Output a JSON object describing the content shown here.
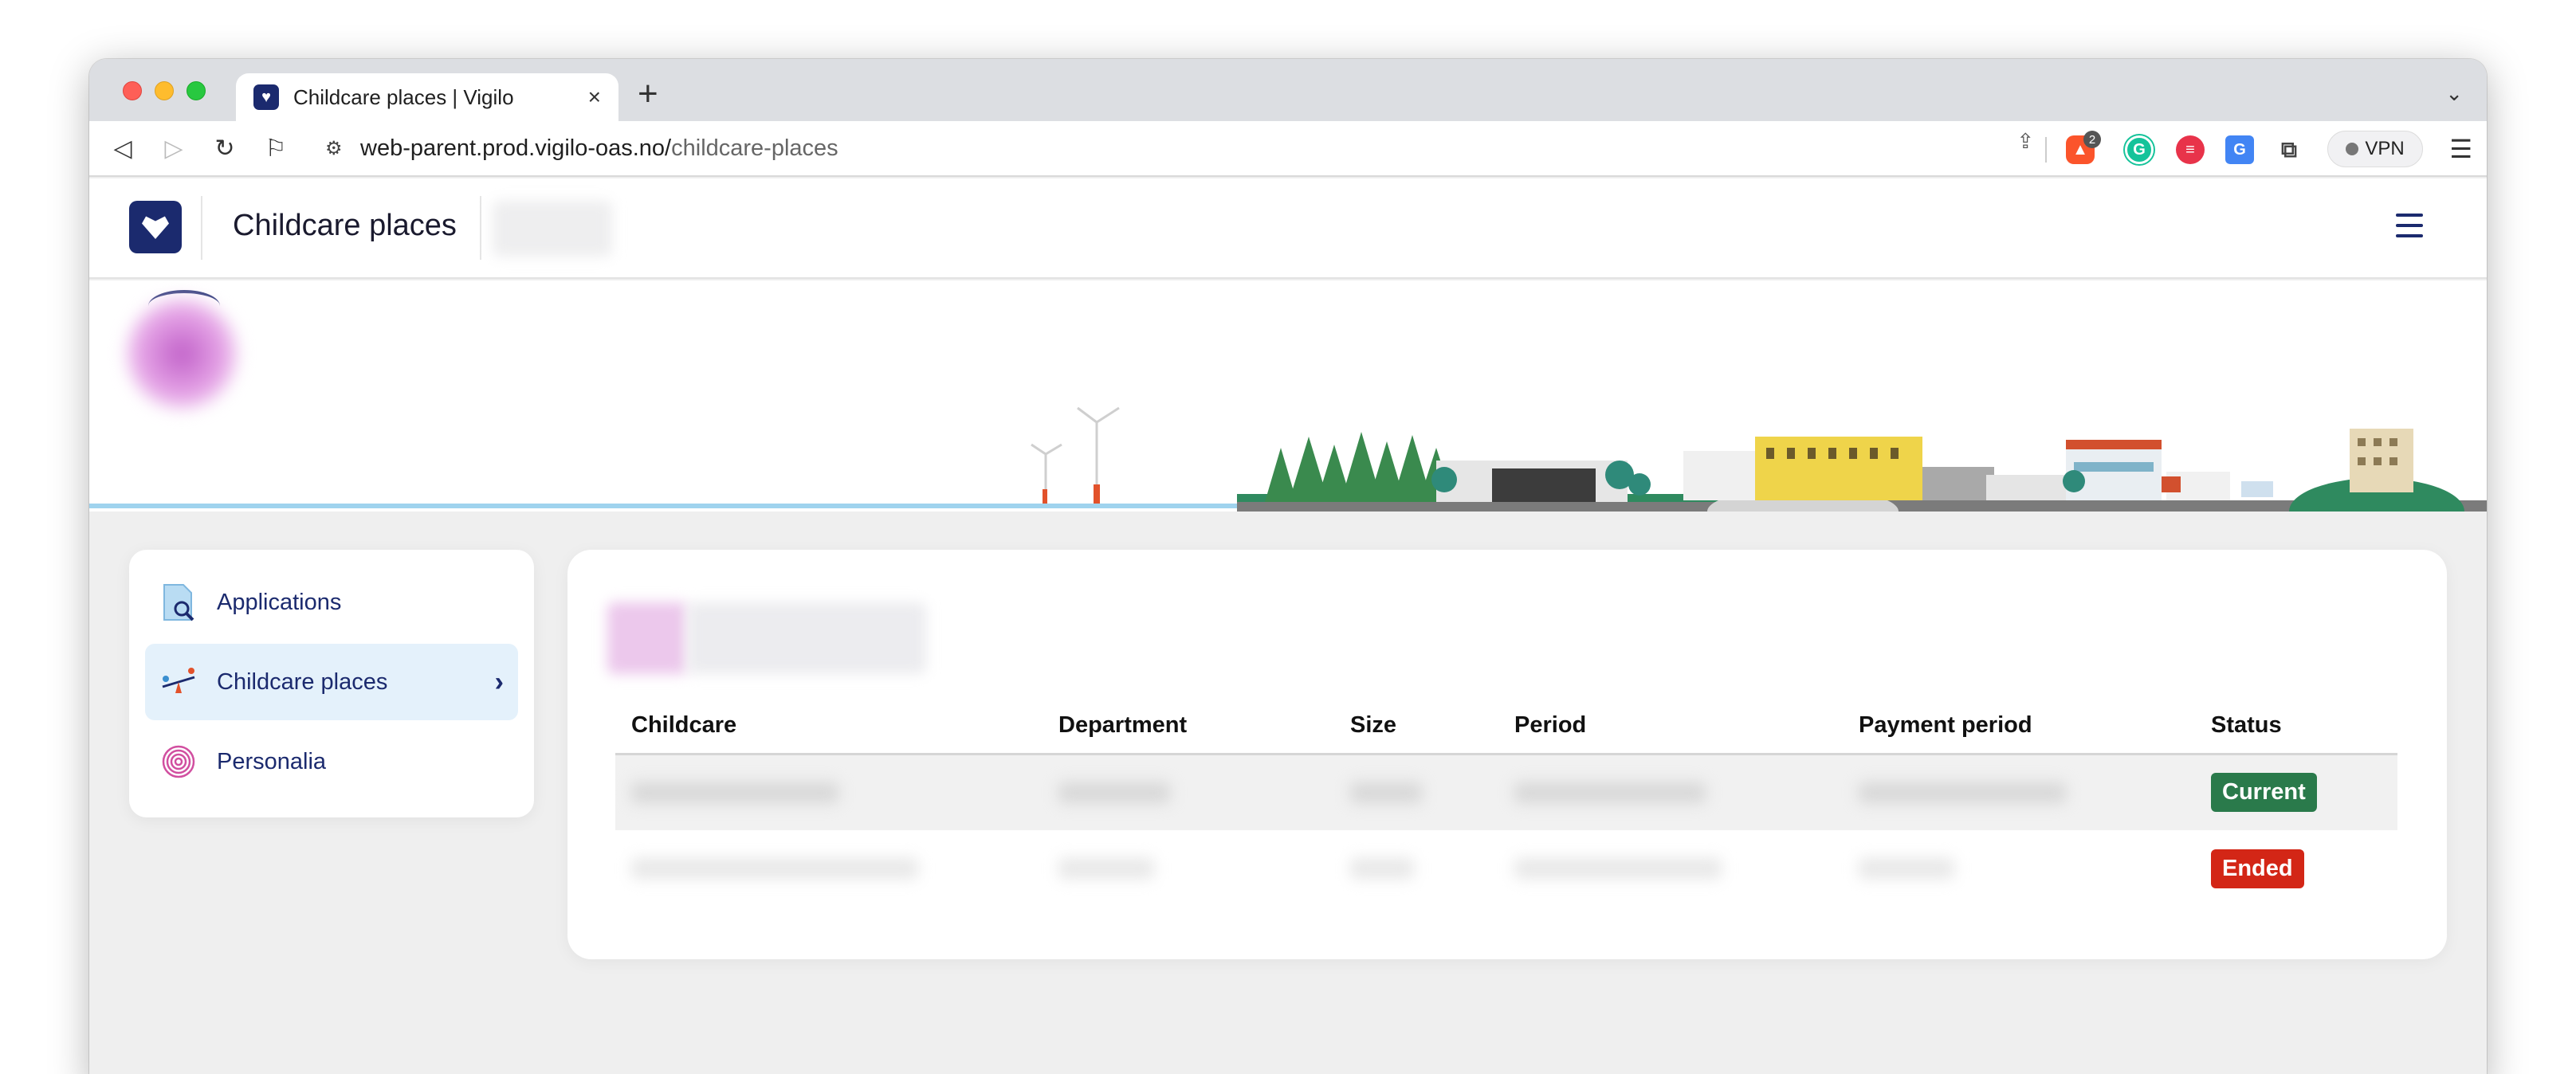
{
  "browser": {
    "tab_title": "Childcare places | Vigilo",
    "tab_close": "×",
    "new_tab": "+",
    "url_host": "web-parent.prod.vigilo-oas.no/",
    "url_path": "childcare-places",
    "brave_badge_count": "2",
    "vpn_label": "VPN"
  },
  "app": {
    "title": "Childcare places"
  },
  "sidebar": {
    "items": [
      {
        "label": "Applications",
        "icon": "document-search-icon",
        "active": false
      },
      {
        "label": "Childcare places",
        "icon": "seesaw-icon",
        "active": true
      },
      {
        "label": "Personalia",
        "icon": "fingerprint-icon",
        "active": false
      }
    ]
  },
  "table": {
    "headers": {
      "childcare": "Childcare",
      "department": "Department",
      "size": "Size",
      "period": "Period",
      "payment_period": "Payment period",
      "status": "Status"
    },
    "rows": [
      {
        "status": "Current",
        "status_color": "#2a7a4b"
      },
      {
        "status": "Ended",
        "status_color": "#d32616"
      }
    ]
  },
  "colors": {
    "brand_navy": "#1b2a6e",
    "active_item_bg": "#e4f1fb"
  }
}
